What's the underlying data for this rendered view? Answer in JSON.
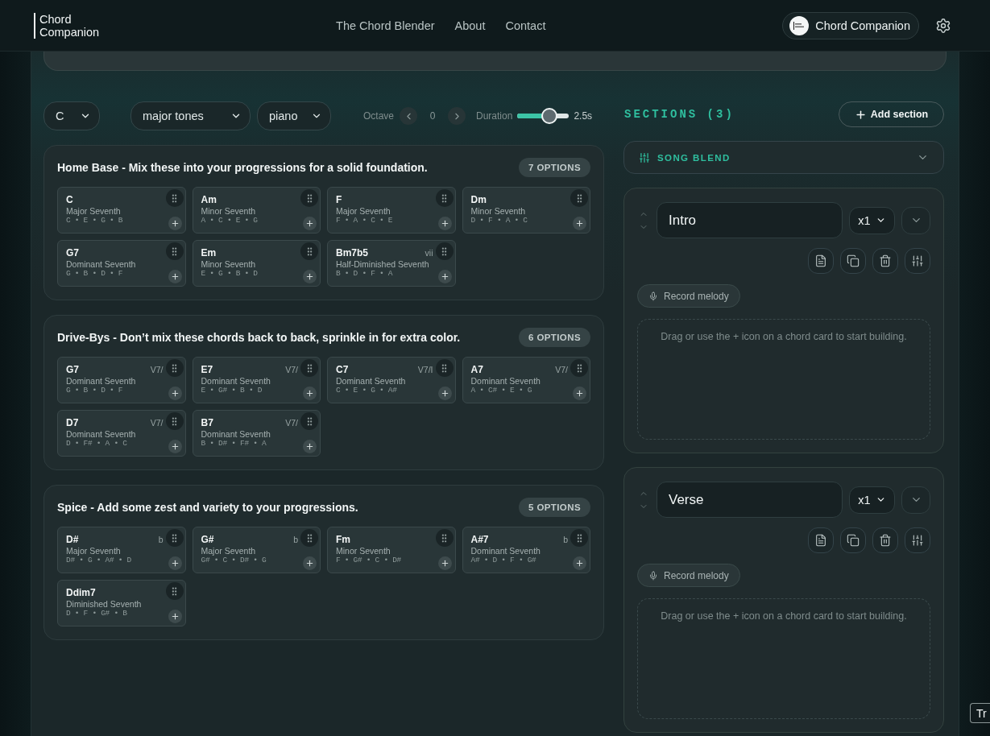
{
  "header": {
    "logo": [
      "Chord",
      "Companion"
    ],
    "nav": [
      "The Chord Blender",
      "About",
      "Contact"
    ],
    "account": "Chord Companion"
  },
  "controls": {
    "key": "C",
    "scale": "major tones",
    "instrument": "piano",
    "octave": {
      "label": "Octave",
      "value": "0"
    },
    "duration": {
      "label": "Duration",
      "level": 0.62,
      "reading": "2.5s"
    }
  },
  "groups": [
    {
      "title": "Home Base - Mix these into your progressions for a solid foundation.",
      "count": "7 OPTIONS",
      "chords": [
        {
          "name": "C",
          "quality": "Major Seventh",
          "notes": "C • E • G • B"
        },
        {
          "name": "Am",
          "quality": "Minor Seventh",
          "notes": "A • C • E • G"
        },
        {
          "name": "F",
          "quality": "Major Seventh",
          "notes": "F • A • C • E"
        },
        {
          "name": "Dm",
          "quality": "Minor Seventh",
          "notes": "D • F • A • C"
        },
        {
          "name": "G7",
          "quality": "Dominant Seventh",
          "notes": "G • B • D • F"
        },
        {
          "name": "Em",
          "quality": "Minor Seventh",
          "notes": "E • G • B • D"
        },
        {
          "name": "Bm7b5",
          "quality": "Half-Diminished Seventh",
          "notes": "B • D • F • A",
          "numeral": "vii"
        }
      ]
    },
    {
      "title": "Drive-Bys - Don’t mix these chords back to back, sprinkle in for extra color.",
      "count": "6 OPTIONS",
      "chords": [
        {
          "name": "G7",
          "quality": "Dominant Seventh",
          "notes": "G • B • D • F",
          "numeral": "V7/"
        },
        {
          "name": "E7",
          "quality": "Dominant Seventh",
          "notes": "E • G# • B • D",
          "numeral": "V7/"
        },
        {
          "name": "C7",
          "quality": "Dominant Seventh",
          "notes": "C • E • G • A#",
          "numeral": "V7/I"
        },
        {
          "name": "A7",
          "quality": "Dominant Seventh",
          "notes": "A • C# • E • G",
          "numeral": "V7/"
        },
        {
          "name": "D7",
          "quality": "Dominant Seventh",
          "notes": "D • F# • A • C",
          "numeral": "V7/"
        },
        {
          "name": "B7",
          "quality": "Dominant Seventh",
          "notes": "B • D# • F# • A",
          "numeral": "V7/"
        }
      ]
    },
    {
      "title": "Spice - Add some zest and variety to your progressions.",
      "count": "5 OPTIONS",
      "chords": [
        {
          "name": "D#",
          "quality": "Major Seventh",
          "notes": "D# • G • A# • D",
          "numeral": "b"
        },
        {
          "name": "G#",
          "quality": "Major Seventh",
          "notes": "G# • C • D# • G",
          "numeral": "b"
        },
        {
          "name": "Fm",
          "quality": "Minor Seventh",
          "notes": "F • G# • C • D#"
        },
        {
          "name": "A#7",
          "quality": "Dominant Seventh",
          "notes": "A# • D • F • G#",
          "numeral": "b"
        },
        {
          "name": "Ddim7",
          "quality": "Diminished Seventh",
          "notes": "D • F • G# • B"
        }
      ]
    }
  ],
  "sections_panel": {
    "title": "SECTIONS (3)",
    "add_button": "Add section",
    "song_blend": {
      "label": "SONG BLEND",
      "expanded": false
    },
    "sections": [
      {
        "name": "Intro",
        "repeat": "x1",
        "record_button": "Record melody",
        "drop_hint": "Drag or use the + icon on a chord card to start building."
      },
      {
        "name": "Verse",
        "repeat": "x1",
        "record_button": "Record melody",
        "drop_hint": "Drag or use the + icon on a chord card to start building."
      }
    ]
  },
  "floating_button": "Tr"
}
